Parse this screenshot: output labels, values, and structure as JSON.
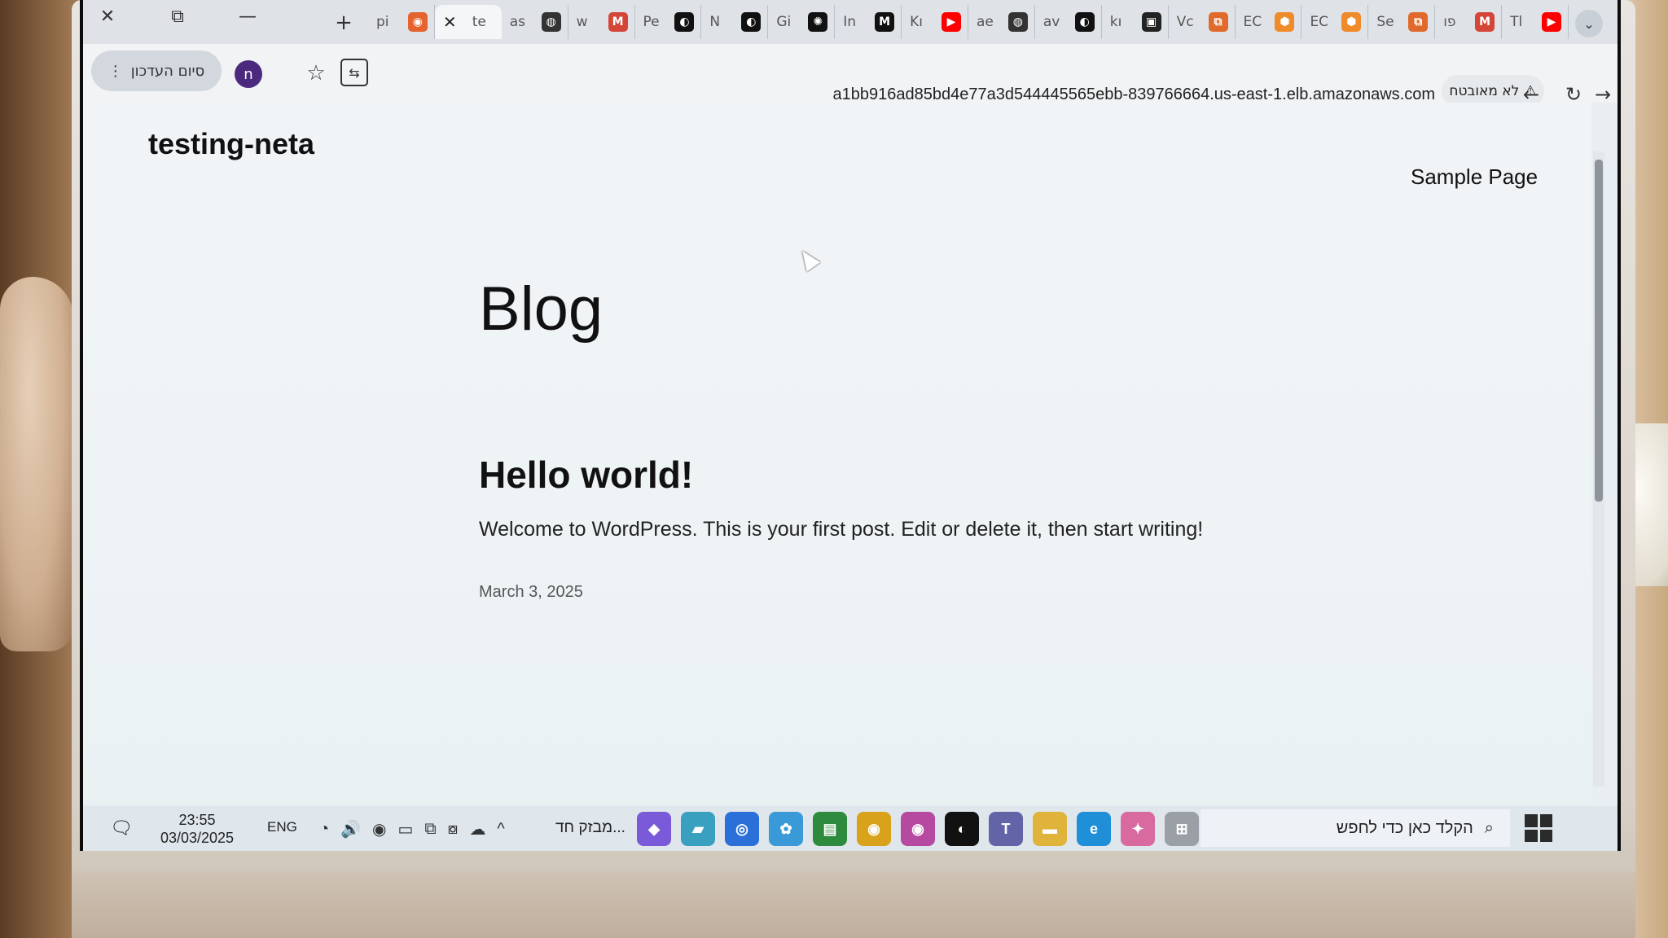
{
  "browser": {
    "window_controls": {
      "close": "✕",
      "restore": "⧉",
      "minimize": "—"
    },
    "new_tab": "+",
    "tabs": [
      {
        "label": "pi",
        "fav_color": "#e4632e",
        "fav_glyph": "◉"
      },
      {
        "label": "te",
        "active": true,
        "fav_color": "",
        "fav_glyph": ""
      },
      {
        "label": "as",
        "fav_color": "#333333",
        "fav_glyph": "◍"
      },
      {
        "label": "w",
        "fav_color": "#d44638",
        "fav_glyph": "M"
      },
      {
        "label": "Pe",
        "fav_color": "#111111",
        "fav_glyph": "◐"
      },
      {
        "label": "N",
        "fav_color": "#111111",
        "fav_glyph": "◐"
      },
      {
        "label": "Gi",
        "fav_color": "#111111",
        "fav_glyph": "✺"
      },
      {
        "label": "In",
        "fav_color": "#111111",
        "fav_glyph": "M"
      },
      {
        "label": "Kı",
        "fav_color": "#ff0000",
        "fav_glyph": "▶"
      },
      {
        "label": "ae",
        "fav_color": "#333333",
        "fav_glyph": "◍"
      },
      {
        "label": "av",
        "fav_color": "#111111",
        "fav_glyph": "◐"
      },
      {
        "label": "kı",
        "fav_color": "#222222",
        "fav_glyph": "▣"
      },
      {
        "label": "Vc",
        "fav_color": "#e06a2b",
        "fav_glyph": "⧉"
      },
      {
        "label": "EC",
        "fav_color": "#f08b2b",
        "fav_glyph": "⬢"
      },
      {
        "label": "EC",
        "fav_color": "#f08b2b",
        "fav_glyph": "⬢"
      },
      {
        "label": "Se",
        "fav_color": "#e06a2b",
        "fav_glyph": "⧉"
      },
      {
        "label": "פו",
        "fav_color": "#d44638",
        "fav_glyph": "M"
      },
      {
        "label": "Tl",
        "fav_color": "#ff0000",
        "fav_glyph": "▶"
      }
    ],
    "tab_search": "⌄",
    "toolbar": {
      "finish_update_label": "סיום העדכון",
      "menu_dots": "⋮",
      "profile_initial": "n",
      "star": "☆",
      "translate": "⇆",
      "url": "a1bb916ad85bd4e77a3d544445565ebb-839766664.us-east-1.elb.amazonaws.com",
      "security_label": "לא מאובטח",
      "security_icon": "⚠",
      "reload": "↻",
      "back": "←",
      "forward": "→"
    }
  },
  "site": {
    "title": "testing-neta",
    "nav": {
      "sample_page": "Sample Page"
    },
    "heading": "Blog",
    "post": {
      "title": "Hello world!",
      "excerpt": "Welcome to WordPress. This is your first post. Edit or delete it, then start writing!",
      "date": "March 3, 2025"
    }
  },
  "taskbar": {
    "notifications_icon": "🗨",
    "time": "23:55",
    "date": "03/03/2025",
    "language": "ENG",
    "tray": [
      "◔",
      "🔊",
      "◉",
      "▭",
      "⧉",
      "⧇",
      "☁",
      "^"
    ],
    "weather": "מבזק חד...",
    "apps": [
      {
        "name": "pin-app",
        "color": "#7a5ad8",
        "glyph": "◆"
      },
      {
        "name": "app-teal",
        "color": "#3aa0c0",
        "glyph": "▰"
      },
      {
        "name": "app-blue",
        "color": "#2b6fd8",
        "glyph": "◎"
      },
      {
        "name": "app-fan",
        "color": "#3a9ad8",
        "glyph": "✿"
      },
      {
        "name": "app-chart",
        "color": "#2e8b3e",
        "glyph": "▤"
      },
      {
        "name": "chrome",
        "color": "#d9a21b",
        "glyph": "◉"
      },
      {
        "name": "chrome-2",
        "color": "#b54aa0",
        "glyph": "◉"
      },
      {
        "name": "github",
        "color": "#111111",
        "glyph": "◐"
      },
      {
        "name": "teams",
        "color": "#6264a7",
        "glyph": "T"
      },
      {
        "name": "explorer",
        "color": "#e0b33a",
        "glyph": "▬"
      },
      {
        "name": "edge",
        "color": "#1f8fd8",
        "glyph": "e"
      },
      {
        "name": "copilot",
        "color": "#d86aa0",
        "glyph": "✦"
      },
      {
        "name": "task-view",
        "color": "#9aa0a6",
        "glyph": "⊞"
      }
    ],
    "search_placeholder": "הקלד כאן כדי לחפש",
    "search_icon": "⌕"
  }
}
